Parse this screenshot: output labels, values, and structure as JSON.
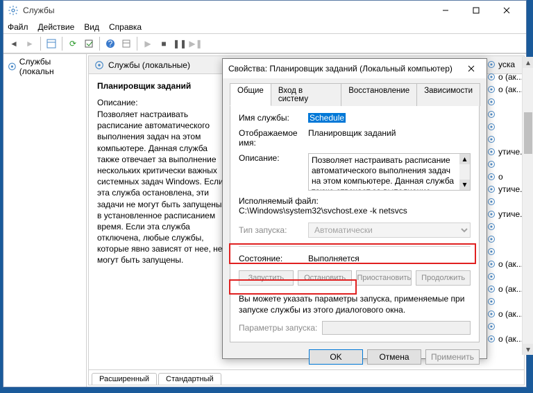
{
  "window": {
    "title": "Службы"
  },
  "menu": {
    "file": "Файл",
    "action": "Действие",
    "view": "Вид",
    "help": "Справка"
  },
  "left": {
    "item": "Службы (локальн"
  },
  "center": {
    "header": "Службы (локальные)",
    "svc_title": "Планировщик заданий",
    "desc_label": "Описание:",
    "desc": "Позволяет настраивать расписание автоматического выполнения задач на этом компьютере. Данная служба также отвечает за выполнение нескольких критически важных системных задач Windows. Если эта служба остановлена, эти задачи не могут быть запущены в установленное расписанием время. Если эта служба отключена, любые службы, которые явно зависят от нее, не могут быть запущены.",
    "tab_ext": "Расширенный",
    "tab_std": "Стандартный"
  },
  "right_list": [
    "уска",
    "о (ак...",
    "о (ак...",
    "",
    "",
    "",
    "",
    "утиче...",
    "",
    "о",
    "утиче...",
    "",
    "утиче...",
    "",
    "",
    "",
    "о (ак...",
    "",
    "о (ак...",
    "",
    "о (ак...",
    "",
    "о (ак..."
  ],
  "dialog": {
    "title": "Свойства: Планировщик заданий (Локальный компьютер)",
    "tabs": {
      "general": "Общие",
      "logon": "Вход в систему",
      "recovery": "Восстановление",
      "deps": "Зависимости"
    },
    "lbl_name": "Имя службы:",
    "val_name": "Schedule",
    "lbl_display": "Отображаемое имя:",
    "val_display": "Планировщик заданий",
    "lbl_desc": "Описание:",
    "val_desc": "Позволяет настраивать расписание автоматического выполнения задач на этом компьютере. Данная служба также отвечает за выполнение нескольких критически важных",
    "lbl_exec": "Исполняемый файл:",
    "val_exec": "C:\\Windows\\system32\\svchost.exe -k netsvcs",
    "lbl_startup": "Тип запуска:",
    "val_startup": "Автоматически",
    "lbl_state": "Состояние:",
    "val_state": "Выполняется",
    "btn_start": "Запустить",
    "btn_stop": "Остановить",
    "btn_pause": "Приостановить",
    "btn_resume": "Продолжить",
    "params_note": "Вы можете указать параметры запуска, применяемые при запуске службы из этого диалогового окна.",
    "lbl_params": "Параметры запуска:",
    "btn_ok": "OK",
    "btn_cancel": "Отмена",
    "btn_apply": "Применить"
  }
}
